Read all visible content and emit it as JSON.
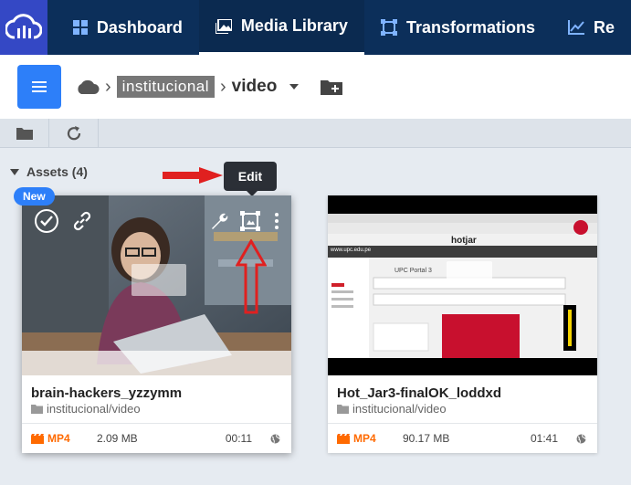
{
  "nav": {
    "items": [
      {
        "label": "Dashboard",
        "icon": "dashboard-icon",
        "active": false
      },
      {
        "label": "Media Library",
        "icon": "media-library-icon",
        "active": true
      },
      {
        "label": "Transformations",
        "icon": "transformations-icon",
        "active": false
      },
      {
        "label": "Re",
        "icon": "reports-icon",
        "active": false
      }
    ]
  },
  "breadcrumb": {
    "root_icon": "cloud-icon",
    "folder": "institucional",
    "current": "video"
  },
  "assets": {
    "header": "Assets (4)",
    "tooltip": "Edit",
    "new_badge": "New"
  },
  "cards": [
    {
      "title": "brain-hackers_yzzymm",
      "path": "institucional/video",
      "format": "MP4",
      "size": "2.09 MB",
      "duration": "00:11"
    },
    {
      "title": "Hot_Jar3-finalOK_loddxd",
      "path": "institucional/video",
      "format": "MP4",
      "size": "90.17 MB",
      "duration": "01:41"
    }
  ],
  "thumb2": {
    "brand": "hotjar",
    "site": "www.upc.edu.pe",
    "heading": "UPC Portal 3"
  },
  "colors": {
    "nav_bg": "#0c2f5a",
    "logo_bg": "#3448c5",
    "accent": "#2d7ff9",
    "format": "#ff6a00",
    "annotation": "#e02020"
  }
}
